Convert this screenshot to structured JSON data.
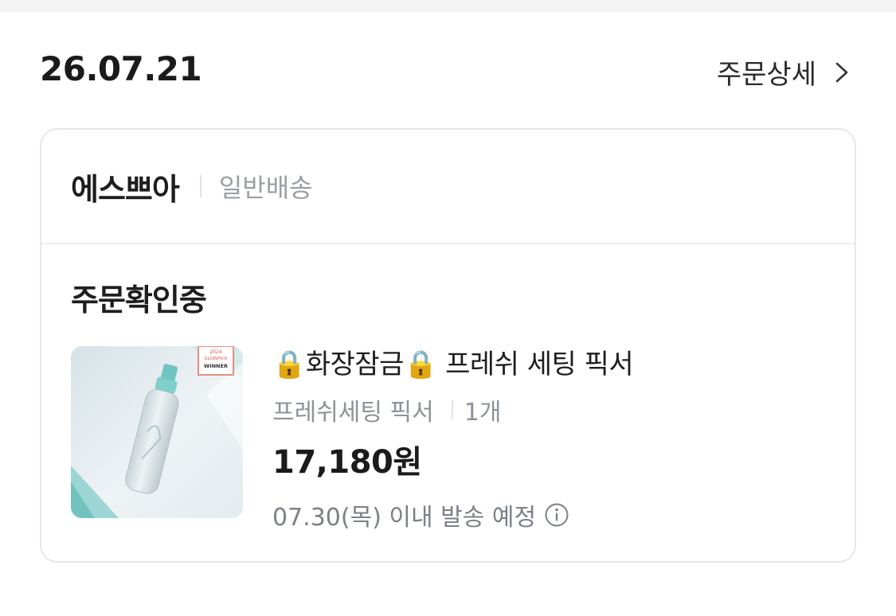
{
  "order": {
    "date": "26.07.21",
    "detail_label": "주문상세"
  },
  "seller": {
    "name": "에스쁘아",
    "shipping_type": "일반배송"
  },
  "status": "주문확인중",
  "product": {
    "title": "🔒화장잠금🔒 프레쉬 세팅 픽서",
    "option": "프레쉬세팅 픽서",
    "quantity": "1개",
    "price": "17,180원",
    "ship_notice": "07.30(목) 이내 발송 예정",
    "badge_lines": [
      "2024",
      "GLOWPICK",
      "WINNER"
    ]
  },
  "icons": {
    "detail_arrow": "chevron-right-icon",
    "ship_info": "info-icon"
  },
  "colors": {
    "primary_text": "#1e1e1e",
    "muted_text": "#9a9ea5",
    "border": "#e6e7ea"
  }
}
